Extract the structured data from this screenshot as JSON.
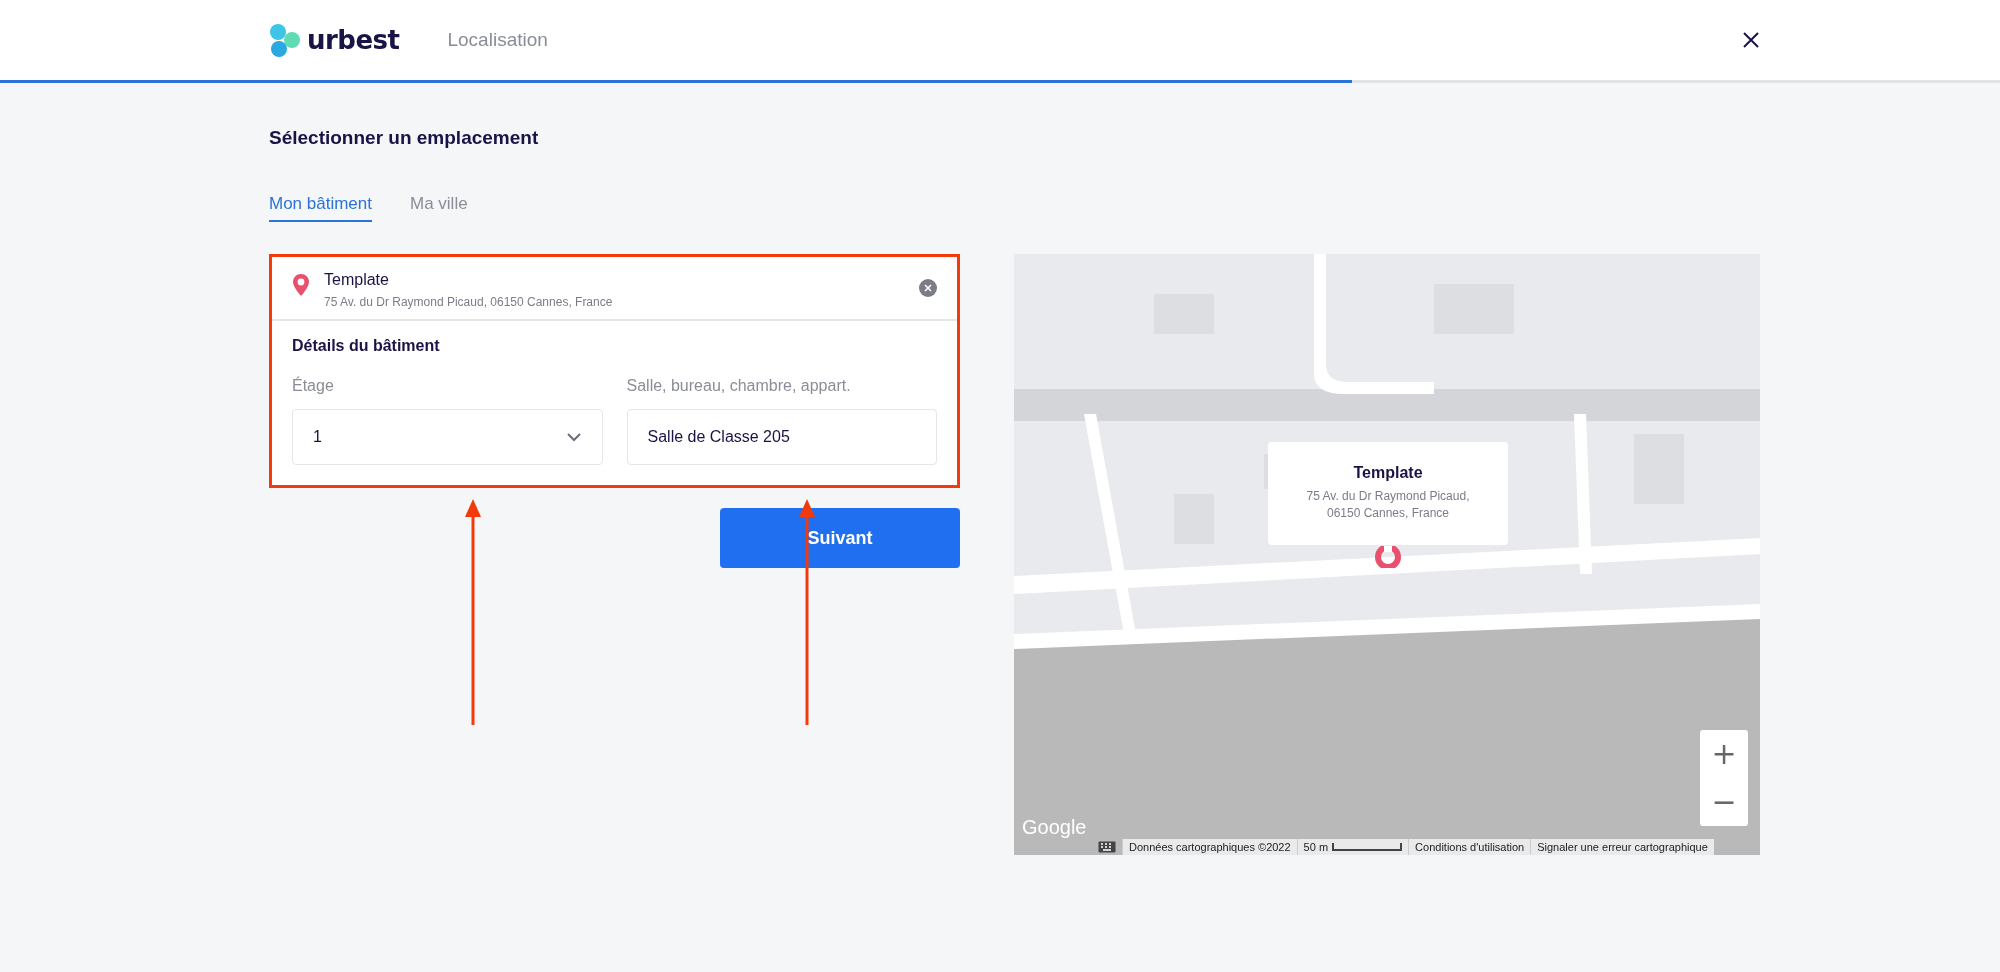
{
  "header": {
    "logo": "urbest",
    "title": "Localisation",
    "progress": {
      "level": 0.676
    }
  },
  "heading": "Sélectionner un emplacement",
  "tabs": [
    {
      "label": "Mon bâtiment",
      "selected": true
    },
    {
      "label": "Ma ville",
      "selected": false
    }
  ],
  "location": {
    "name": "Template",
    "address": "75 Av. du Dr Raymond Picaud, 06150 Cannes, France",
    "highlighted": true
  },
  "details": {
    "title": "Détails du bâtiment",
    "fields": [
      {
        "kind": "select",
        "label": "Étage",
        "value": "1",
        "arrow": true
      },
      {
        "kind": "text",
        "label": "Salle, bureau, chambre, appart.",
        "value": "Salle de Classe 205",
        "arrow": true
      }
    ]
  },
  "next_button": "Suivant",
  "map": {
    "popup": {
      "title": "Template",
      "address_lines": [
        "75 Av. du Dr Raymond Picaud,",
        "06150 Cannes, France"
      ]
    },
    "zoom_in": "+",
    "zoom_out": "−",
    "attribution": {
      "logo": "Google",
      "data": "Données cartographiques ©2022",
      "scale": "50 m",
      "terms": "Conditions d'utilisation",
      "report": "Signaler une erreur cartographique"
    }
  }
}
